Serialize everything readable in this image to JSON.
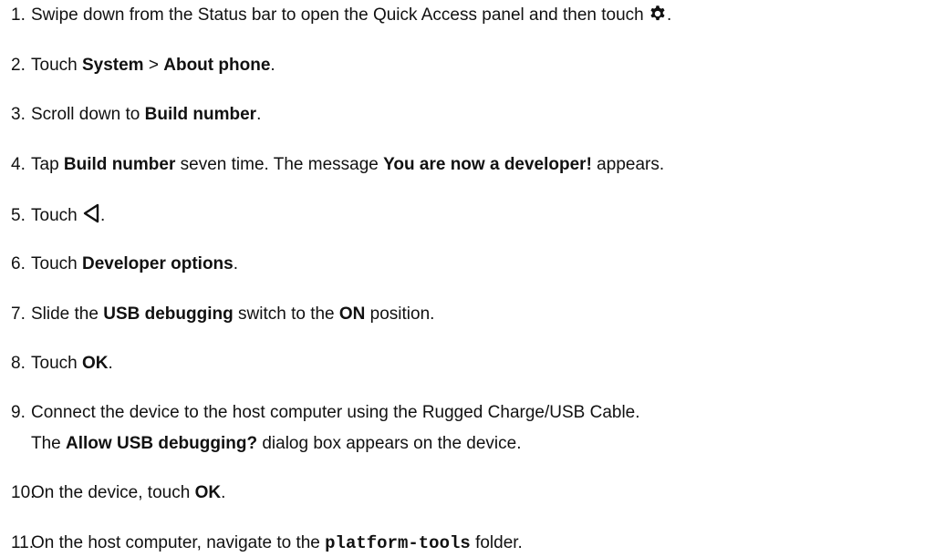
{
  "steps": [
    {
      "num": "1.",
      "parts": [
        "Swipe down from the Status bar to open the Quick Access panel and then touch ",
        "."
      ],
      "icon": "gear-icon"
    },
    {
      "num": "2.",
      "a": "Touch ",
      "b1": "System",
      "c": " > ",
      "b2": "About phone",
      "d": "."
    },
    {
      "num": "3.",
      "a": "Scroll down to ",
      "b1": "Build number",
      "d": "."
    },
    {
      "num": "4.",
      "a": "Tap ",
      "b1": "Build number",
      "c": " seven time. The message ",
      "b2": "You are now a developer!",
      "d": " appears."
    },
    {
      "num": "5.",
      "parts": [
        "Touch ",
        "."
      ],
      "icon": "back-triangle-icon"
    },
    {
      "num": "6.",
      "a": "Touch ",
      "b1": "Developer options",
      "d": "."
    },
    {
      "num": "7.",
      "a": "Slide the ",
      "b1": "USB debugging",
      "c": " switch to the ",
      "b2": "ON",
      "d": " position."
    },
    {
      "num": "8.",
      "a": "Touch ",
      "b1": "OK",
      "d": "."
    },
    {
      "num": "9.",
      "a": "Connect the device to the host computer using the Rugged Charge/USB Cable.",
      "line2a": "The ",
      "line2b": "Allow USB debugging?",
      "line2c": " dialog box appears on the device."
    },
    {
      "num": "10.",
      "a": "On the device, touch ",
      "b1": "OK",
      "d": "."
    },
    {
      "num": "11.",
      "a": "On the host computer, navigate to the ",
      "mono": "platform-tools",
      "d": " folder."
    }
  ]
}
